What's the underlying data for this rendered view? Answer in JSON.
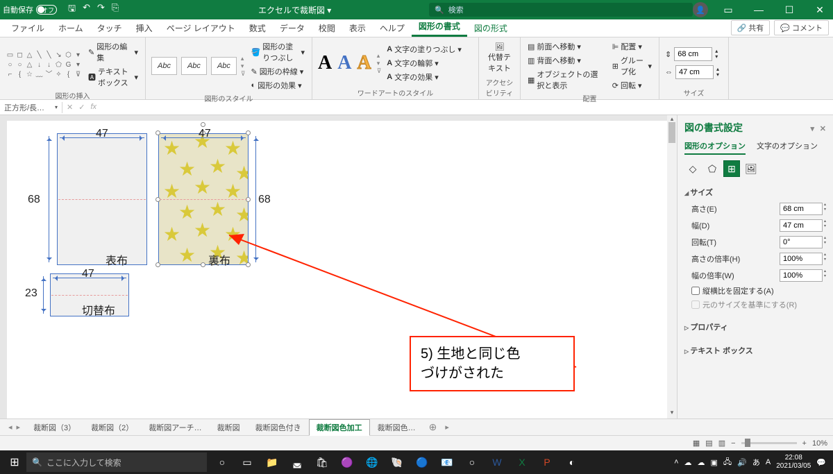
{
  "titlebar": {
    "autosave_label": "自動保存",
    "autosave_state": "オフ",
    "doc_title": "エクセルで裁断図",
    "search_placeholder": "検索"
  },
  "ribbon_tabs": [
    "ファイル",
    "ホーム",
    "タッチ",
    "挿入",
    "ページ レイアウト",
    "数式",
    "データ",
    "校閲",
    "表示",
    "ヘルプ",
    "図形の書式",
    "図の形式"
  ],
  "ribbon_active_tab": "図形の書式",
  "share_label": "共有",
  "comment_label": "コメント",
  "ribbon": {
    "insert_shapes": "図形の挿入",
    "edit_shape": "図形の編集",
    "text_box": "テキスト ボックス",
    "shape_styles": "図形のスタイル",
    "shape_fill": "図形の塗りつぶし",
    "shape_outline": "図形の枠線",
    "shape_effects": "図形の効果",
    "wordart_styles": "ワードアートのスタイル",
    "text_fill": "文字の塗りつぶし",
    "text_outline": "文字の輪郭",
    "text_effects": "文字の効果",
    "alt_text": "代替テキスト",
    "accessibility": "アクセシビリティ",
    "bring_forward": "前面へ移動",
    "send_backward": "背面へ移動",
    "selection_pane": "オブジェクトの選択と表示",
    "align": "配置",
    "group": "グループ化",
    "rotate": "回転",
    "arrange": "配置",
    "size": "サイズ",
    "height_value": "68 cm",
    "width_value": "47 cm",
    "abc": "Abc"
  },
  "name_box": "正方形/長…",
  "canvas": {
    "dim_47_a": "47",
    "dim_47_b": "47",
    "dim_47_c": "47",
    "dim_68_a": "68",
    "dim_68_b": "68",
    "dim_23": "23",
    "label_omote": "表布",
    "label_ura": "裏布",
    "label_kirikae": "切替布",
    "callout_line1": "5) 生地と同じ色",
    "callout_line2": "づけがされた"
  },
  "format_pane": {
    "title": "図の書式設定",
    "shape_options": "図形のオプション",
    "text_options": "文字のオプション",
    "section_size": "サイズ",
    "height": "高さ(E)",
    "height_val": "68 cm",
    "width": "幅(D)",
    "width_val": "47 cm",
    "rotation": "回転(T)",
    "rotation_val": "0°",
    "scale_h": "高さの倍率(H)",
    "scale_h_val": "100%",
    "scale_w": "幅の倍率(W)",
    "scale_w_val": "100%",
    "lock_ratio": "縦横比を固定する(A)",
    "relative_orig": "元のサイズを基準にする(R)",
    "section_properties": "プロパティ",
    "section_textbox": "テキスト ボックス"
  },
  "sheet_tabs": [
    "裁断図（3）",
    "裁断図（2）",
    "裁断図アーチ…",
    "裁断図",
    "裁断図色付き",
    "裁断図色加工",
    "裁断図色…"
  ],
  "sheet_active": "裁断図色加工",
  "zoom": "10%",
  "taskbar": {
    "search_placeholder": "ここに入力して検索",
    "time": "22:08",
    "date": "2021/03/05"
  }
}
